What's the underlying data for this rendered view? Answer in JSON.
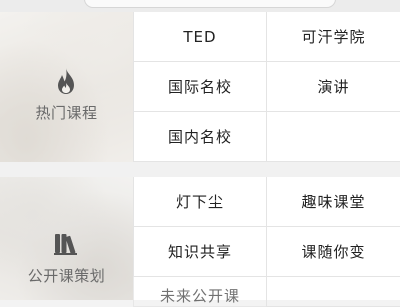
{
  "sections": [
    {
      "category": {
        "label": "热门课程",
        "icon": "flame-icon"
      },
      "items": [
        "TED",
        "可汗学院",
        "国际名校",
        "演讲",
        "国内名校",
        ""
      ]
    },
    {
      "category": {
        "label": "公开课策划",
        "icon": "books-icon"
      },
      "items": [
        "灯下尘",
        "趣味课堂",
        "知识共享",
        "课随你变",
        "未来公开课",
        ""
      ]
    }
  ],
  "colors": {
    "icon": "#5a5a5a",
    "text": "#222222",
    "divider": "#e4e4e4"
  }
}
